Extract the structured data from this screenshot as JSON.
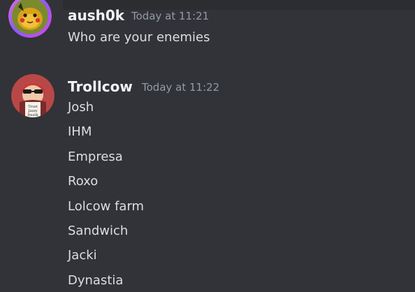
{
  "messages": [
    {
      "username": "aush0k",
      "timestamp": "Today at 11:21",
      "avatar_icon": "pikachu-avatar-icon",
      "lines": [
        "Who are your enemies"
      ]
    },
    {
      "username": "Trollcow",
      "timestamp": "Today at 11:22",
      "avatar_icon": "trollcow-avatar-icon",
      "lines": [
        "Josh",
        "IHM",
        "Empresa",
        "Roxo",
        "Lolcow farm",
        "Sandwich",
        "Jacki",
        "Dynastia"
      ]
    }
  ],
  "colors": {
    "background": "#313338",
    "username": "#f2f3f5",
    "timestamp": "#949ba4",
    "text": "#dbdee1"
  }
}
